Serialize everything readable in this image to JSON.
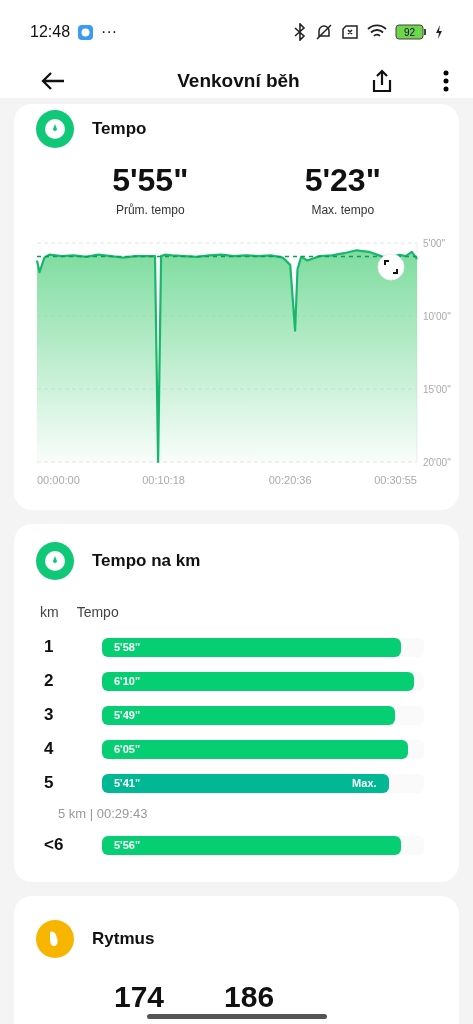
{
  "status_bar": {
    "time": "12:48",
    "more": "···",
    "battery": "92"
  },
  "header": {
    "title": "Venkovní běh"
  },
  "tempo_card": {
    "title": "Tempo",
    "stats": [
      {
        "value": "5'55\"",
        "label": "Prům. tempo"
      },
      {
        "value": "5'23\"",
        "label": "Max. tempo"
      }
    ],
    "chart": {
      "y_labels": [
        "5'00\"",
        "10'00\"",
        "15'00\"",
        "20'00\""
      ],
      "x_labels": [
        "00:00:00",
        "00:10:18",
        "00:20:36",
        "00:30:55"
      ]
    }
  },
  "km_card": {
    "title": "Tempo na km",
    "columns": [
      "km",
      "Tempo"
    ],
    "rows": [
      {
        "km": "1",
        "pace": "5'58\"",
        "level": 0.93
      },
      {
        "km": "2",
        "pace": "6'10\"",
        "level": 0.97
      },
      {
        "km": "3",
        "pace": "5'49\"",
        "level": 0.91
      },
      {
        "km": "4",
        "pace": "6'05\"",
        "level": 0.95
      },
      {
        "km": "5",
        "pace": "5'41\"",
        "level": 0.89,
        "badge": "Max."
      },
      {
        "kind": "summary",
        "text": "5 km | 00:29:43"
      },
      {
        "km": "<6",
        "pace": "5'56\"",
        "level": 0.93
      }
    ]
  },
  "cadence_card": {
    "title": "Rytmus",
    "stats": [
      "174",
      "186"
    ]
  }
}
